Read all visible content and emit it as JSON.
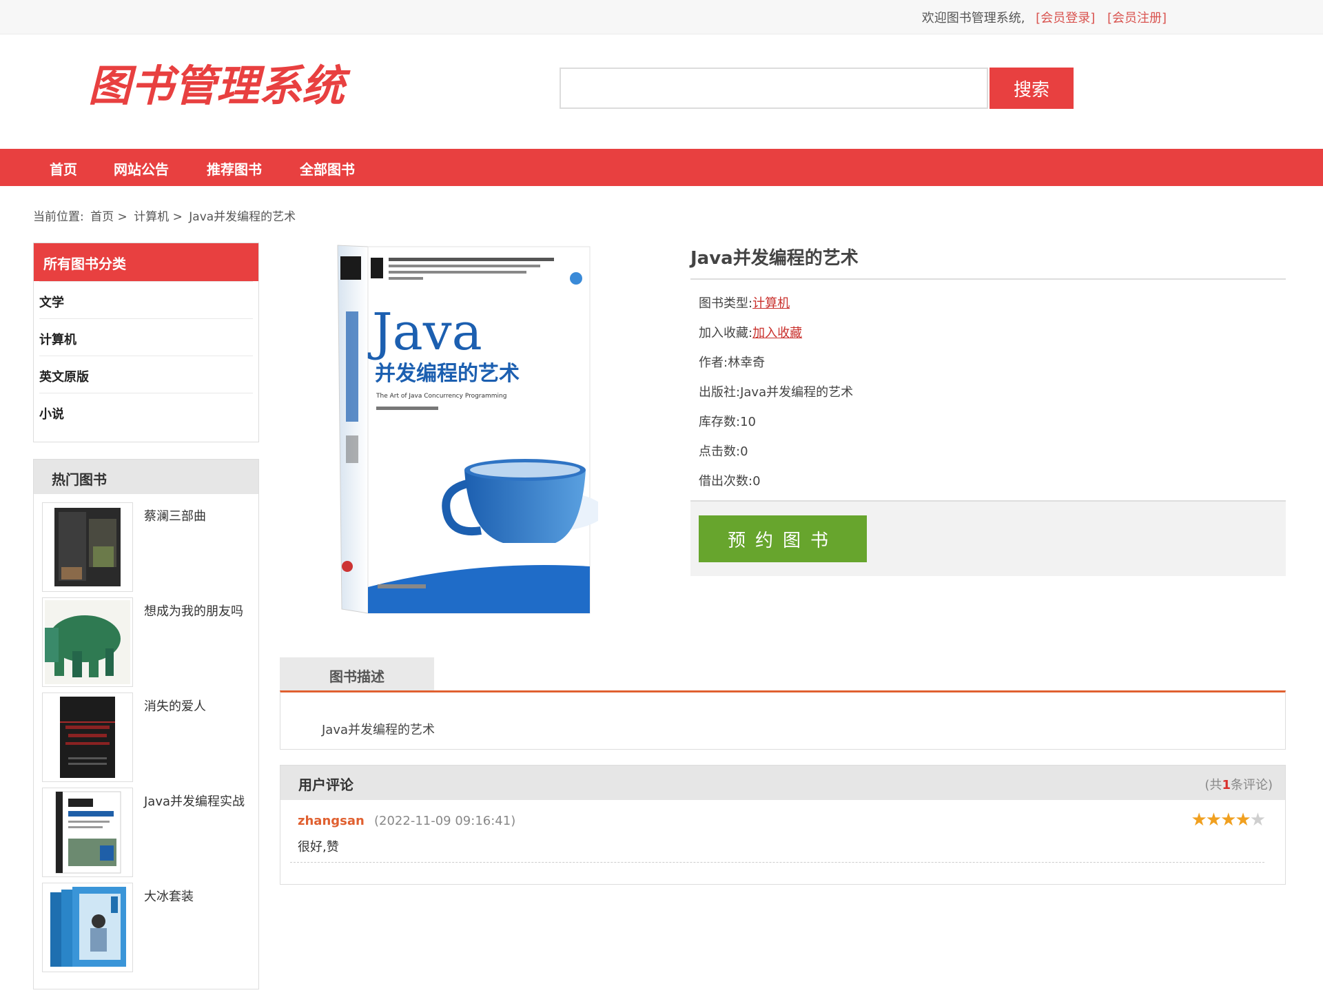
{
  "topbar": {
    "welcome": "欢迎图书管理系统,",
    "login_label": "[会员登录]",
    "register_label": "[会员注册]"
  },
  "header": {
    "logo_text": "图书管理系统",
    "search_placeholder": "",
    "search_value": "",
    "search_button": "搜索"
  },
  "nav": {
    "items": [
      {
        "label": "首页"
      },
      {
        "label": "网站公告"
      },
      {
        "label": "推荐图书"
      },
      {
        "label": "全部图书"
      }
    ]
  },
  "breadcrumb": {
    "prefix": "当前位置:",
    "items": [
      "首页 >",
      "计算机 >",
      "Java并发编程的艺术"
    ]
  },
  "sidebar": {
    "categories_title": "所有图书分类",
    "categories": [
      "文学",
      "计算机",
      "英文原版",
      "小说"
    ],
    "hot_title": "热门图书",
    "hot_books": [
      {
        "title": "蔡澜三部曲"
      },
      {
        "title": "想成为我的朋友吗"
      },
      {
        "title": "消失的爱人"
      },
      {
        "title": "Java并发编程实战"
      },
      {
        "title": "大冰套装"
      }
    ]
  },
  "book": {
    "title": "Java并发编程的艺术",
    "cover_big": "Java",
    "cover_sub": "并发编程的艺术",
    "cover_en": "The Art of Java Concurrency Programming",
    "type_label": "图书类型:",
    "type_value": "计算机",
    "fav_label": "加入收藏:",
    "fav_value": "加入收藏",
    "author_label": "作者:",
    "author_value": "林幸奇",
    "publisher_label": "出版社:",
    "publisher_value": "Java并发编程的艺术",
    "stock_label": "库存数:",
    "stock_value": "10",
    "clicks_label": "点击数:",
    "clicks_value": "0",
    "borrow_label": "借出次数:",
    "borrow_value": "0",
    "reserve_button": "预约图书"
  },
  "description": {
    "tab_label": "图书描述",
    "text": "Java并发编程的艺术"
  },
  "comments": {
    "title": "用户评论",
    "count_prefix": "(共",
    "count": "1",
    "count_suffix": "条评论)",
    "items": [
      {
        "user": "zhangsan",
        "time": "(2022-11-09 09:16:41)",
        "text": "很好,赞",
        "rating": 4,
        "max": 5
      }
    ]
  },
  "colors": {
    "brand_red": "#e84040",
    "reserve_green": "#67a52d",
    "link_red": "#c9302c",
    "star": "#f0a020"
  }
}
